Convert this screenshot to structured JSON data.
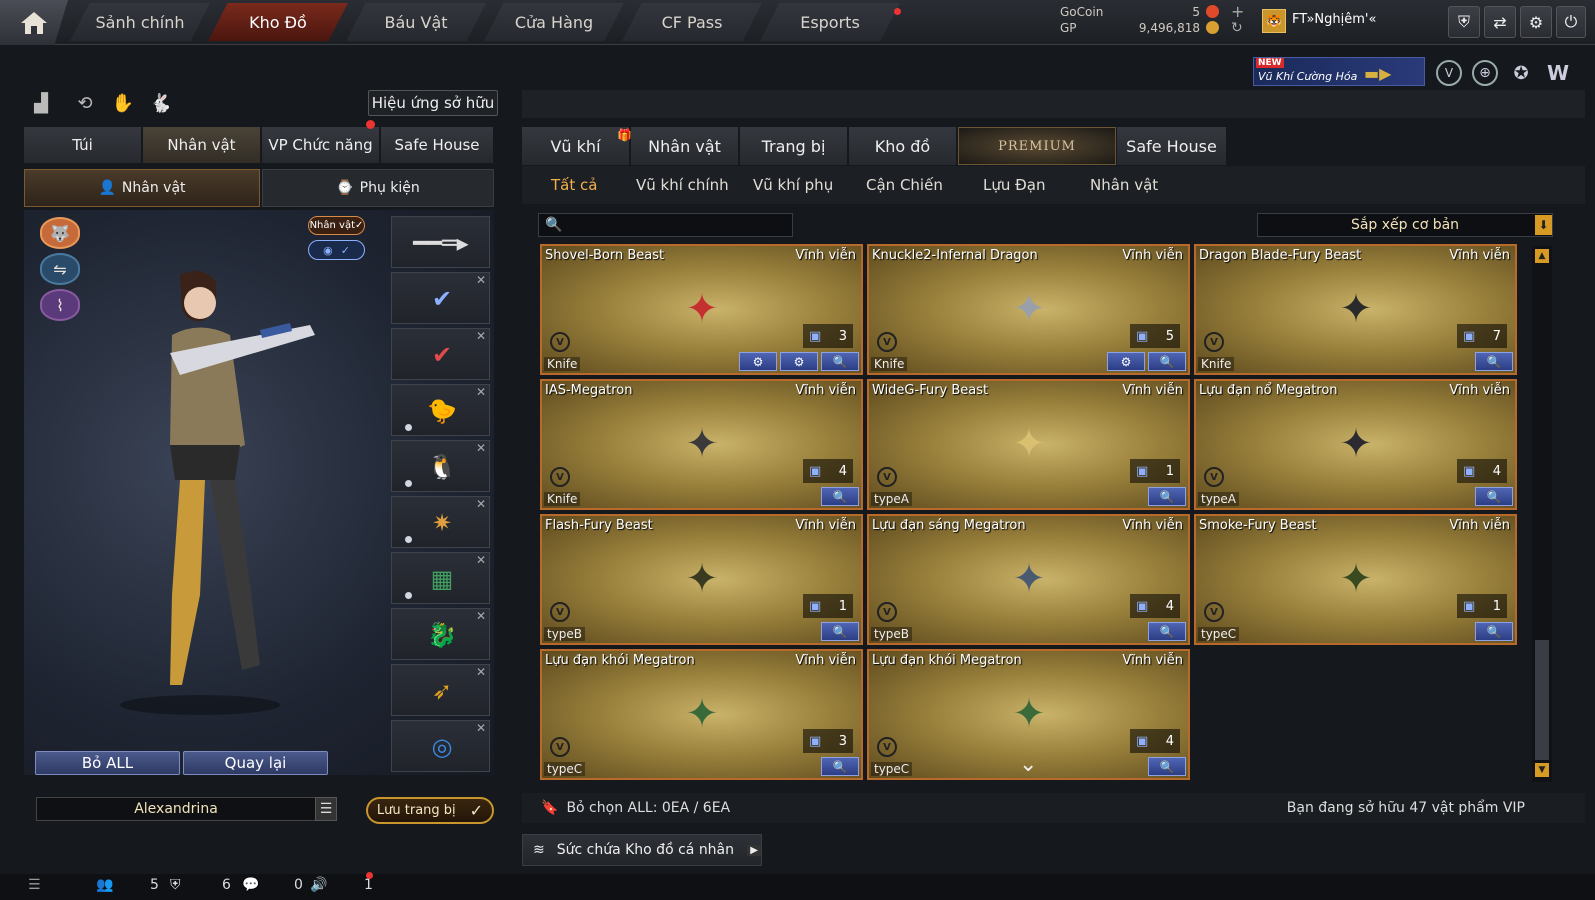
{
  "topnav": {
    "tabs": [
      "Sảnh chính",
      "Kho Đồ",
      "Báu Vật",
      "Cửa Hàng",
      "CF Pass",
      "Esports"
    ],
    "active": "Kho Đồ"
  },
  "currency": {
    "gocoin_label": "GoCoin",
    "gp_label": "GP",
    "gocoin_value": "5",
    "gp_value": "9,496,818"
  },
  "player": {
    "name": "FT»Nghịêm'«"
  },
  "promo": {
    "badge": "NEW",
    "text": "Vũ Khí Cường Hóa"
  },
  "left": {
    "effect_button": "Hiệu ứng sở hữu",
    "tabs": [
      "Túi",
      "Nhân vật",
      "VP Chức năng",
      "Safe House"
    ],
    "subtabs": [
      "Nhân vật",
      "Phụ kiện"
    ],
    "char_tag": "Nhân vật",
    "remove_all": "Bỏ ALL",
    "back": "Quay lại",
    "character_name": "Alexandrina",
    "save_equip": "Lưu trang bị"
  },
  "right": {
    "tabs": [
      "Vũ khí",
      "Nhân vật",
      "Trang bị",
      "Kho đồ",
      "PREMIUM",
      "Safe House"
    ],
    "filters": [
      "Tất cả",
      "Vũ khí chính",
      "Vũ khí phụ",
      "Cận Chiến",
      "Lựu Đạn",
      "Nhân vật"
    ],
    "search_placeholder": "",
    "sort_label": "Sắp xếp cơ bản",
    "items": [
      {
        "name": "Shovel-Born Beast",
        "duration": "Vĩnh viễn",
        "type": "Knife",
        "qty": "3",
        "btns": [
          "settings",
          "settings",
          "search"
        ],
        "color": "#c43030"
      },
      {
        "name": "Knuckle2-Infernal Dragon",
        "duration": "Vĩnh viễn",
        "type": "Knife",
        "qty": "5",
        "btns": [
          "settings",
          "search"
        ],
        "color": "#9aa0aa"
      },
      {
        "name": "Dragon Blade-Fury Beast",
        "duration": "Vĩnh viễn",
        "type": "Knife",
        "qty": "7",
        "btns": [
          "search"
        ],
        "color": "#2a2a2a"
      },
      {
        "name": "IAS-Megatron",
        "duration": "Vĩnh viễn",
        "type": "Knife",
        "qty": "4",
        "btns": [
          "search"
        ],
        "color": "#3a3a3a"
      },
      {
        "name": "WideG-Fury Beast",
        "duration": "Vĩnh viễn",
        "type": "typeA",
        "qty": "1",
        "btns": [
          "search"
        ],
        "color": "#d8c070"
      },
      {
        "name": "Lựu đạn nổ Megatron",
        "duration": "Vĩnh viễn",
        "type": "typeA",
        "qty": "4",
        "btns": [
          "search"
        ],
        "color": "#2a2a30"
      },
      {
        "name": "Flash-Fury Beast",
        "duration": "Vĩnh viễn",
        "type": "typeB",
        "qty": "1",
        "btns": [
          "search"
        ],
        "color": "#3a3a20"
      },
      {
        "name": "Lựu đạn sáng Megatron",
        "duration": "Vĩnh viễn",
        "type": "typeB",
        "qty": "4",
        "btns": [
          "search"
        ],
        "color": "#4a5a70"
      },
      {
        "name": "Smoke-Fury Beast",
        "duration": "Vĩnh viễn",
        "type": "typeC",
        "qty": "1",
        "btns": [
          "search"
        ],
        "color": "#3a4a20"
      },
      {
        "name": "Lựu đạn khói Megatron",
        "duration": "Vĩnh viễn",
        "type": "typeC",
        "qty": "3",
        "btns": [
          "search"
        ],
        "color": "#3a6a3a"
      },
      {
        "name": "Lựu đạn khói Megatron",
        "duration": "Vĩnh viễn",
        "type": "typeC",
        "qty": "4",
        "btns": [
          "search"
        ],
        "color": "#3a6a3a"
      }
    ],
    "deselect": "Bỏ chọn ALL: 0EA / 6EA",
    "vip_owned": "Bạn đang sở hữu 47 vật phẩm VIP",
    "capacity": "Sức chứa Kho đồ cá nhân"
  },
  "status": {
    "friends": "5",
    "clan": "6",
    "chat": "0",
    "voice": "1"
  },
  "colors": {
    "accent": "#f0b04a",
    "card_border": "#b86a2a",
    "button_blue": "#3a4f9e"
  }
}
